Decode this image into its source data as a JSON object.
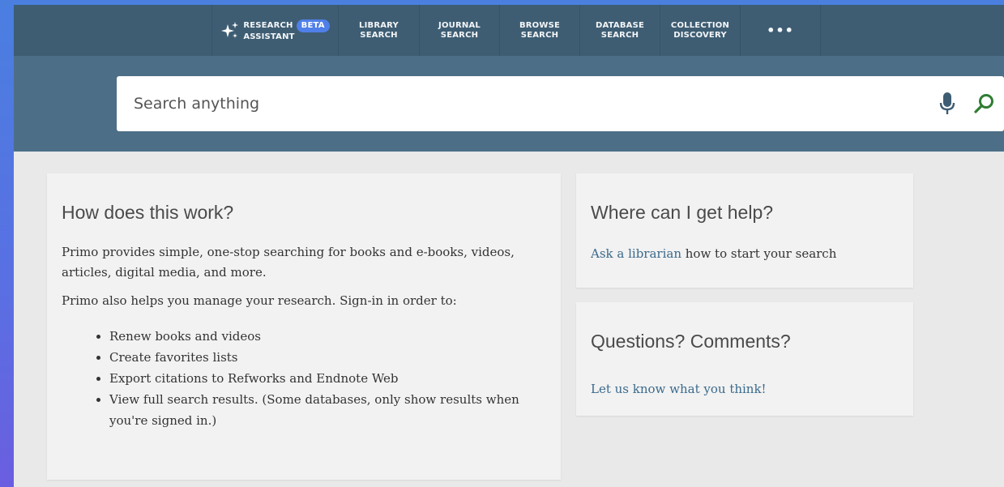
{
  "nav": {
    "research_assistant": {
      "line1": "RESEARCH",
      "line2": "ASSISTANT",
      "badge": "BETA"
    },
    "items": [
      {
        "line1": "LIBRARY",
        "line2": "SEARCH"
      },
      {
        "line1": "JOURNAL",
        "line2": "SEARCH"
      },
      {
        "line1": "BROWSE",
        "line2": "SEARCH"
      },
      {
        "line1": "DATABASE",
        "line2": "SEARCH"
      },
      {
        "line1": "COLLECTION",
        "line2": "DISCOVERY"
      }
    ],
    "more": "•••"
  },
  "search": {
    "placeholder": "Search anything",
    "value": ""
  },
  "how": {
    "title": "How does this work?",
    "para1": "Primo provides simple, one-stop searching for books and e-books, videos, articles, digital media, and more.",
    "para2": "Primo also helps you manage your research. Sign-in in order to:",
    "bullets": [
      "Renew books and videos",
      "Create favorites lists",
      "Export citations to Refworks and Endnote Web",
      "View full search results. (Some databases, only show results when you're signed in.)"
    ]
  },
  "help": {
    "title": "Where can I get help?",
    "link": "Ask a librarian",
    "text": " how to start your search"
  },
  "questions": {
    "title": "Questions? Comments?",
    "link": "Let us know what you think!"
  },
  "colors": {
    "nav_bg": "#3e5d73",
    "band_bg": "#4c6f87",
    "accent_search": "#2e7d32",
    "link": "#3a6a8c",
    "beta_badge": "#4f7fe8"
  }
}
